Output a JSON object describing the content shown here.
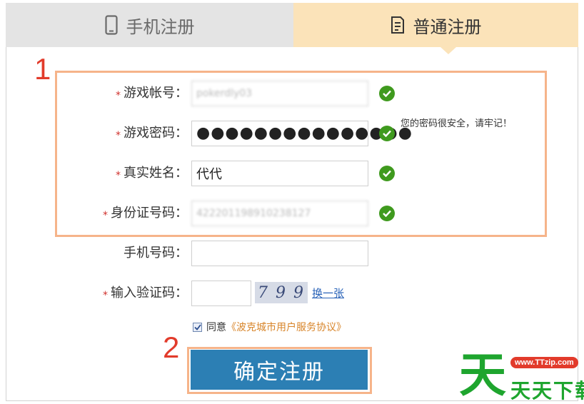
{
  "tabs": {
    "phone_label": "手机注册",
    "normal_label": "普通注册",
    "active": "normal"
  },
  "annotations": {
    "step1": "1",
    "step2": "2"
  },
  "form": {
    "account": {
      "label": "游戏帐号：",
      "value": "pokerdly03",
      "valid": true
    },
    "password": {
      "label": "游戏密码：",
      "value": "●●●●●●●●●●●●●●●",
      "valid": true,
      "hint": "您的密码很安全，请牢记！"
    },
    "realname": {
      "label": "真实姓名：",
      "value": "代代",
      "valid": true
    },
    "idcard": {
      "label": "身份证号码：",
      "value": "422201198910238127",
      "valid": true
    },
    "phone": {
      "label": "手机号码：",
      "value": ""
    },
    "captcha": {
      "label": "输入验证码：",
      "value": "",
      "image_text": "7 9 9",
      "refresh_label": "换一张"
    },
    "required_mark": "*"
  },
  "agreement": {
    "checked": true,
    "prefix": "同意",
    "link": "《波克城市用户服务协议》"
  },
  "submit_label": "确定注册",
  "watermark": {
    "big": "天",
    "url": "www.TTzip.com",
    "text": "天天下载"
  },
  "colors": {
    "accent": "#2c7fb4",
    "check": "#3f9a1e",
    "highlight": "#f6b48a",
    "tab_active": "#fbe3b9",
    "annotation": "#e23b2b"
  }
}
